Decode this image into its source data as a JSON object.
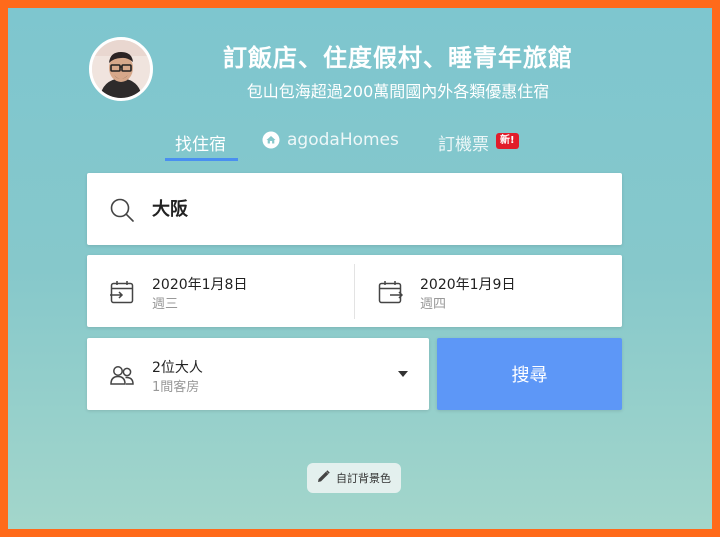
{
  "hero": {
    "title": "訂飯店、住度假村、睡青年旅館",
    "subtitle": "包山包海超過200萬間國內外各類優惠住宿"
  },
  "tabs": [
    {
      "label": "找住宿",
      "active": true,
      "icon": ""
    },
    {
      "label": "agodaHomes",
      "active": false,
      "icon": "home-icon"
    },
    {
      "label": "訂機票",
      "active": false,
      "icon": "",
      "badge": "新!"
    }
  ],
  "search": {
    "value": "大阪",
    "icon": "search-icon"
  },
  "dates": {
    "checkin": {
      "date": "2020年1月8日",
      "weekday": "週三",
      "icon": "calendar-in-icon"
    },
    "checkout": {
      "date": "2020年1月9日",
      "weekday": "週四",
      "icon": "calendar-out-icon"
    }
  },
  "guests": {
    "adults": "2位大人",
    "rooms": "1間客房",
    "icon": "people-icon"
  },
  "search_button": {
    "label": "搜尋"
  },
  "background_button": {
    "label": "自訂背景色",
    "icon": "pencil-icon"
  },
  "colors": {
    "frame": "#ff6a1a",
    "accent": "#5d97f7",
    "tab_indicator": "#4a8ff0",
    "badge": "#e11d2b"
  }
}
